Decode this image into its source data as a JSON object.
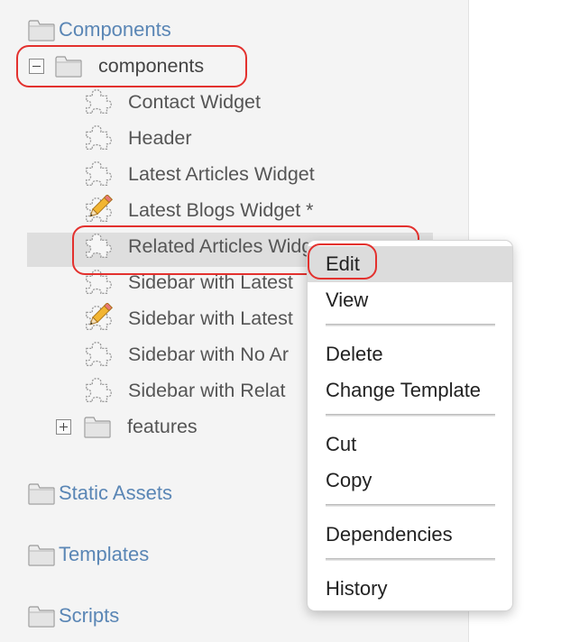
{
  "tree": {
    "components_root": "Components",
    "components_folder": "components",
    "children": [
      {
        "label": "Contact Widget",
        "icon": "puzzle-icon"
      },
      {
        "label": "Header",
        "icon": "puzzle-icon"
      },
      {
        "label": "Latest Articles Widget",
        "icon": "puzzle-icon"
      },
      {
        "label": "Latest Blogs Widget *",
        "icon": "puzzle-pencil-icon"
      },
      {
        "label": "Related Articles Widget",
        "icon": "puzzle-icon"
      },
      {
        "label": "Sidebar with Latest",
        "icon": "puzzle-icon"
      },
      {
        "label": "Sidebar with Latest",
        "icon": "puzzle-pencil-icon"
      },
      {
        "label": "Sidebar with No Ar",
        "icon": "puzzle-icon"
      },
      {
        "label": "Sidebar with Relat",
        "icon": "puzzle-icon"
      }
    ],
    "features_folder": "features",
    "other_roots": [
      "Static Assets",
      "Templates",
      "Scripts"
    ]
  },
  "context_menu": {
    "items": [
      "Edit",
      "View",
      "Delete",
      "Change Template",
      "Cut",
      "Copy",
      "Dependencies",
      "History"
    ],
    "highlighted": "Edit"
  },
  "colors": {
    "root_link": "#5a86b5",
    "label": "#555555",
    "highlight_ring": "#e3312e",
    "selected_row": "#dedede"
  }
}
